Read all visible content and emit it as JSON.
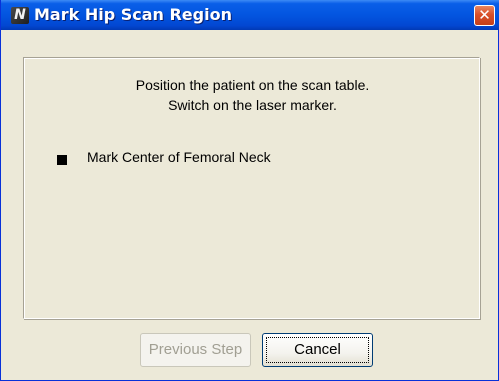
{
  "window": {
    "title": "Mark Hip Scan Region",
    "app_icon_glyph": "N",
    "close_glyph": "✕",
    "app_icon": "app-logo-icon",
    "close_icon": "close-icon"
  },
  "instructions": {
    "line1": "Position the patient on the scan table.",
    "line2": "Switch on the laser marker."
  },
  "steps": [
    {
      "label": "Mark Center of Femoral Neck",
      "active": true
    }
  ],
  "buttons": {
    "previous": {
      "label": "Previous Step",
      "enabled": false
    },
    "cancel": {
      "label": "Cancel",
      "enabled": true,
      "focused": true
    }
  },
  "colors": {
    "titlebar": "#0355e0",
    "dialog_bg": "#ece9d8",
    "close_button": "#d9502a",
    "disabled_text": "#a19f93"
  }
}
